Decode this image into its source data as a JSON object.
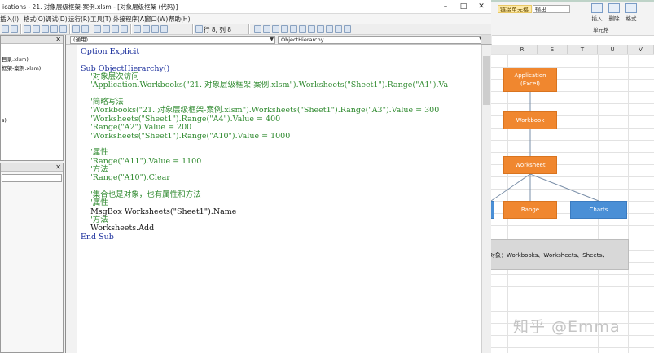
{
  "excel": {
    "ribbon": {
      "cell_style": "链接单元格",
      "output": "输出",
      "insert": "插入",
      "delete": "删除",
      "format": "格式",
      "group": "单元格"
    },
    "columns": [
      "R",
      "S",
      "T",
      "U",
      "V"
    ],
    "diagram": {
      "application": "Application",
      "application_sub": "(Excel)",
      "workbook": "Workbook",
      "worksheet": "Worksheet",
      "range": "Range",
      "charts": "Charts"
    },
    "note": "对象：Workbooks、Worksheets、Sheets、",
    "watermark": "知乎 @Emma",
    "colors": {
      "orange": "#f0872f",
      "blue": "#4a8fd6"
    }
  },
  "vbe": {
    "title": "ications - 21. 对象层级框架-案例.xlsm - [对象层级框架 (代码)]",
    "window_buttons": {
      "minimize": "–",
      "maximize": "□",
      "close": "✕"
    },
    "menu": [
      {
        "name": "menu-insert",
        "label": "插入(I)"
      },
      {
        "name": "menu-format",
        "label": "格式(O)"
      },
      {
        "name": "menu-debug",
        "label": "调试(D)"
      },
      {
        "name": "menu-run",
        "label": "运行(R)"
      },
      {
        "name": "menu-tools",
        "label": "工具(T)"
      },
      {
        "name": "menu-addins",
        "label": "外接程序(A)"
      },
      {
        "name": "menu-window",
        "label": "窗口(W)"
      },
      {
        "name": "menu-help",
        "label": "帮助(H)"
      }
    ],
    "toolbar_status": "行 8, 列 8",
    "project_tree": [
      {
        "label": "目录.xlsm)"
      },
      {
        "label": "框架-案例.xlsm)"
      },
      {
        "label": ""
      },
      {
        "label": ""
      },
      {
        "label": ""
      },
      {
        "label": ""
      },
      {
        "label": ""
      },
      {
        "label": "s)"
      }
    ],
    "object_combo": "(通用)",
    "proc_combo": "ObjectHierarchy",
    "code_lines": [
      {
        "cls": "kw",
        "text": "Option Explicit"
      },
      {
        "cls": "tx",
        "text": ""
      },
      {
        "cls": "kw",
        "text": "Sub ObjectHierarchy()"
      },
      {
        "cls": "cm",
        "text": "    '对象层次访问"
      },
      {
        "cls": "cm",
        "text": "    'Application.Workbooks(\"21. 对象层级框架-案例.xlsm\").Worksheets(\"Sheet1\").Range(\"A1\").Va"
      },
      {
        "cls": "tx",
        "text": ""
      },
      {
        "cls": "cm",
        "text": "    '简略写法"
      },
      {
        "cls": "cm",
        "text": "    'Workbooks(\"21. 对象层级框架-案例.xlsm\").Worksheets(\"Sheet1\").Range(\"A3\").Value = 300"
      },
      {
        "cls": "cm",
        "text": "    'Worksheets(\"Sheet1\").Range(\"A4\").Value = 400"
      },
      {
        "cls": "cm",
        "text": "    'Range(\"A2\").Value = 200"
      },
      {
        "cls": "cm",
        "text": "    'Worksheets(\"Sheet1\").Range(\"A10\").Value = 1000"
      },
      {
        "cls": "tx",
        "text": ""
      },
      {
        "cls": "cm",
        "text": "    '属性"
      },
      {
        "cls": "cm",
        "text": "    'Range(\"A11\").Value = 1100"
      },
      {
        "cls": "cm",
        "text": "    '方法"
      },
      {
        "cls": "cm",
        "text": "    'Range(\"A10\").Clear"
      },
      {
        "cls": "tx",
        "text": ""
      },
      {
        "cls": "cm",
        "text": "    '集合也是对象，也有属性和方法"
      },
      {
        "cls": "cm",
        "text": "    '属性"
      },
      {
        "cls": "tx",
        "text": "    MsgBox Worksheets(\"Sheet1\").Name"
      },
      {
        "cls": "cm",
        "text": "    '方法"
      },
      {
        "cls": "tx",
        "text": "    Worksheets.Add"
      },
      {
        "cls": "kw",
        "text": "End Sub"
      }
    ]
  }
}
